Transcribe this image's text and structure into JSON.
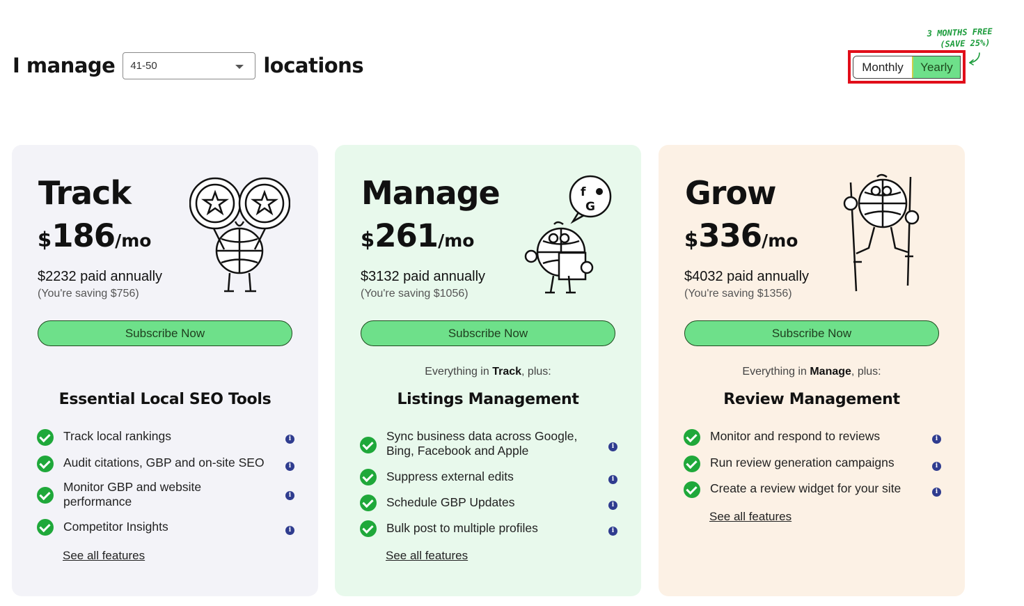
{
  "header": {
    "prefix": "I manage",
    "selected_locations": "41-50",
    "suffix": "locations"
  },
  "promo": {
    "line1": "3 MONTHS FREE",
    "line2": "(SAVE 25%)"
  },
  "billing_toggle": {
    "monthly_label": "Monthly",
    "yearly_label": "Yearly",
    "selected": "Yearly"
  },
  "plans": [
    {
      "name": "Track",
      "currency": "$",
      "price": "186",
      "per": "/mo",
      "annual": "$2232 paid annually",
      "saving": "(You're saving $756)",
      "cta": "Subscribe Now",
      "section_title": "Essential Local SEO Tools",
      "features": [
        "Track local rankings",
        "Audit citations, GBP and on-site SEO",
        "Monitor GBP and website performance",
        "Competitor Insights"
      ],
      "see_all": "See all features"
    },
    {
      "name": "Manage",
      "currency": "$",
      "price": "261",
      "per": "/mo",
      "annual": "$3132 paid annually",
      "saving": "(You're saving $1056)",
      "cta": "Subscribe Now",
      "everything_prefix": "Everything in",
      "everything_plan": "Track",
      "everything_suffix": ", plus:",
      "section_title": "Listings Management",
      "features": [
        "Sync business data across Google, Bing, Facebook and Apple",
        "Suppress external edits",
        "Schedule GBP Updates",
        "Bulk post to multiple profiles"
      ],
      "see_all": "See all features"
    },
    {
      "name": "Grow",
      "currency": "$",
      "price": "336",
      "per": "/mo",
      "annual": "$4032 paid annually",
      "saving": "(You're saving $1356)",
      "cta": "Subscribe Now",
      "everything_prefix": "Everything in",
      "everything_plan": "Manage",
      "everything_suffix": ", plus:",
      "section_title": "Review Management",
      "features": [
        "Monitor and respond to reviews",
        "Run review generation campaigns",
        "Create a review widget for your site"
      ],
      "see_all": "See all features"
    }
  ],
  "icons": {
    "info": "i",
    "check": "check-icon",
    "social_badges": [
      "f",
      "G"
    ]
  },
  "colors": {
    "accent_green": "#6ee08a",
    "check_green": "#1fa83a",
    "highlight_red": "#e10e1a",
    "info_blue": "#2f3c8f",
    "promo_green": "#1a9b3a"
  }
}
